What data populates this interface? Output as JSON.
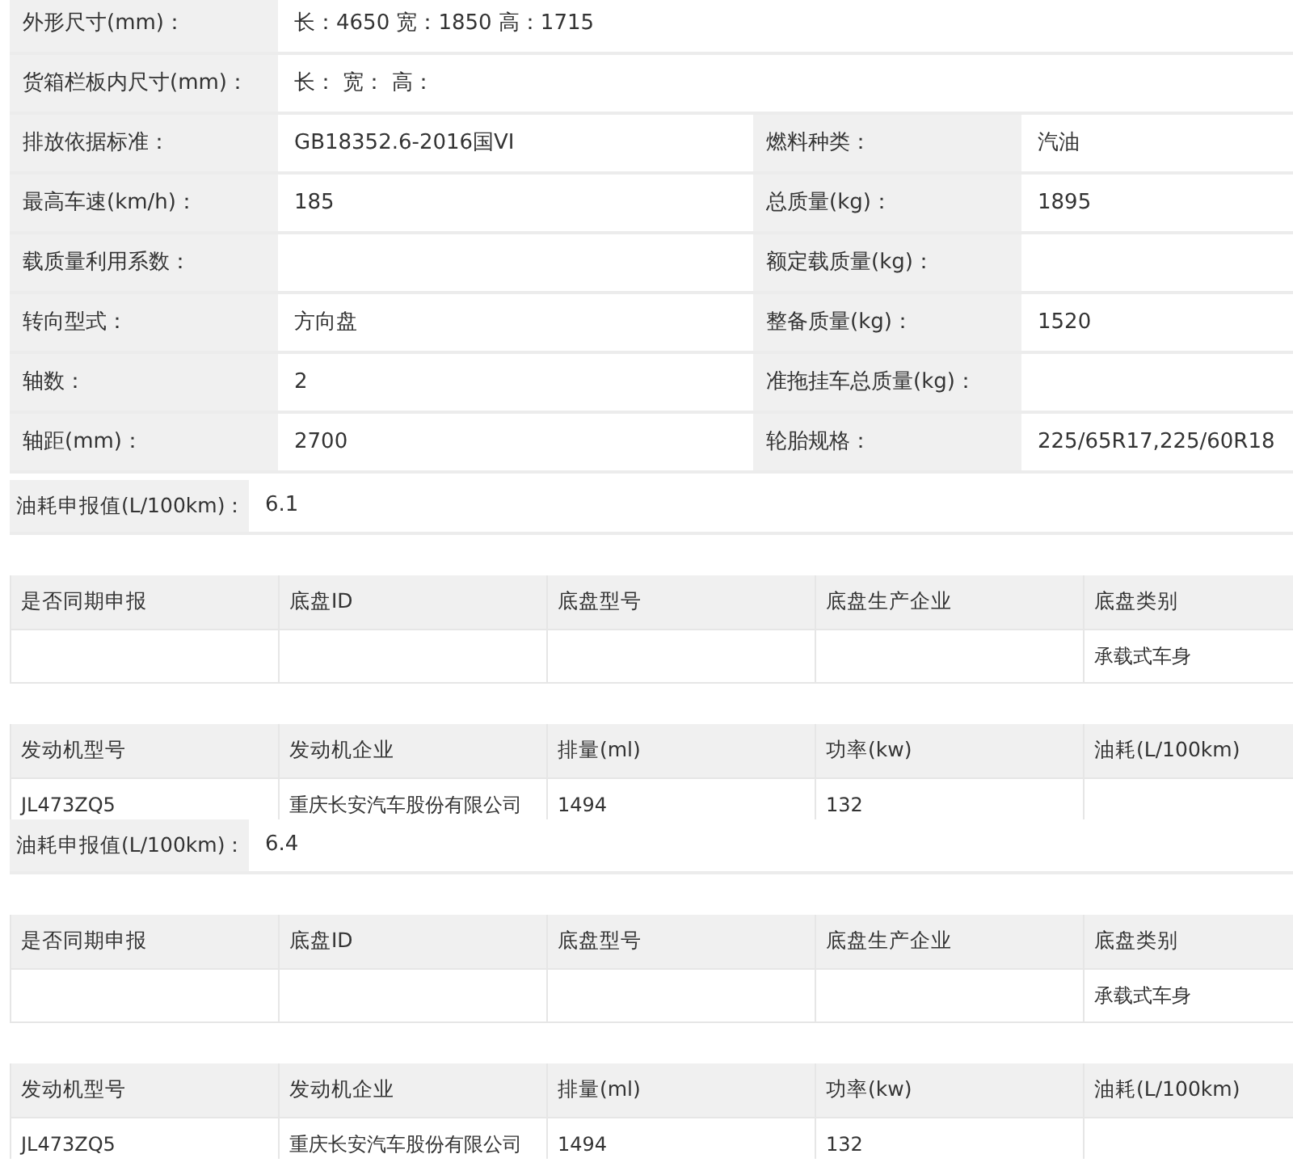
{
  "sections": [
    {
      "kind": "spec",
      "rows": [
        [
          {
            "label": "外形尺寸(mm)：",
            "value": "长：4650 宽：1850 高：1715"
          }
        ],
        [
          {
            "label": "货箱栏板内尺寸(mm)：",
            "value": "长： 宽： 高："
          }
        ],
        [
          {
            "label": "排放依据标准：",
            "value": "GB18352.6-2016国VI"
          },
          {
            "label": "燃料种类：",
            "value": "汽油"
          }
        ],
        [
          {
            "label": "最高车速(km/h)：",
            "value": "185"
          },
          {
            "label": "总质量(kg)：",
            "value": "1895"
          }
        ],
        [
          {
            "label": "载质量利用系数："
          },
          {
            "label": "额定载质量(kg)："
          }
        ],
        [
          {
            "label": "转向型式：",
            "value": "方向盘"
          },
          {
            "label": "整备质量(kg)：",
            "value": "1520"
          }
        ],
        [
          {
            "label": "轴数：",
            "value": "2"
          },
          {
            "label": "准拖挂车总质量(kg)："
          }
        ],
        [
          {
            "label": "轴距(mm)：",
            "value": "2700"
          },
          {
            "label": "轮胎规格：",
            "value": "225/65R17,225/60R18"
          }
        ]
      ]
    },
    {
      "kind": "fuel",
      "label": "油耗申报值(L/100km)：",
      "value": "6.1"
    },
    {
      "kind": "grid",
      "columns": [
        "是否同期申报",
        "底盘ID",
        "底盘型号",
        "底盘生产企业",
        "底盘类别"
      ],
      "rows": [
        [
          null,
          null,
          null,
          null,
          "承载式车身"
        ]
      ]
    },
    {
      "kind": "grid",
      "short": true,
      "columns": [
        "发动机型号",
        "发动机企业",
        "排量(ml)",
        "功率(kw)",
        "油耗(L/100km)"
      ],
      "rows": [
        [
          "JL473ZQ5",
          "重庆长安汽车股份有限公司",
          "1494",
          "132",
          null
        ]
      ]
    },
    {
      "kind": "fuel",
      "label": "油耗申报值(L/100km)：",
      "value": "6.4"
    },
    {
      "kind": "grid",
      "columns": [
        "是否同期申报",
        "底盘ID",
        "底盘型号",
        "底盘生产企业",
        "底盘类别"
      ],
      "rows": [
        [
          null,
          null,
          null,
          null,
          "承载式车身"
        ]
      ]
    },
    {
      "kind": "grid",
      "short": true,
      "columns": [
        "发动机型号",
        "发动机企业",
        "排量(ml)",
        "功率(kw)",
        "油耗(L/100km)"
      ],
      "rows": [
        [
          "JL473ZQ5",
          "重庆长安汽车股份有限公司",
          "1494",
          "132"
        ]
      ]
    }
  ]
}
